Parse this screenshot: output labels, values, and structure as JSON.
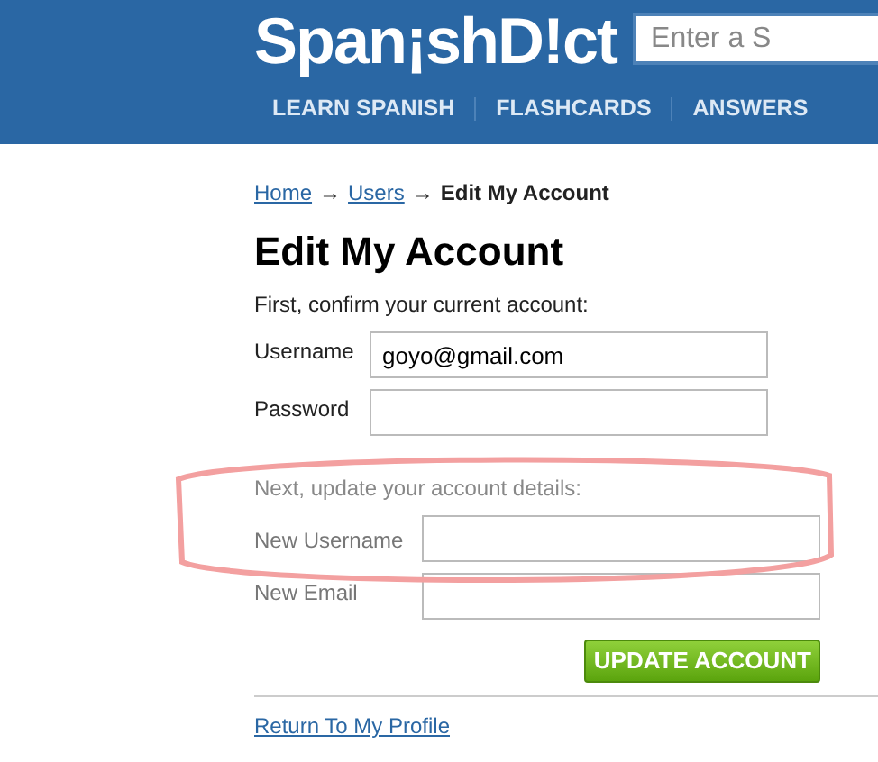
{
  "header": {
    "logo": "Span¡shD!ct",
    "search": {
      "placeholder": "Enter a S"
    },
    "nav": [
      "LEARN SPANISH",
      "FLASHCARDS",
      "ANSWERS"
    ]
  },
  "breadcrumb": {
    "links": [
      "Home",
      "Users"
    ],
    "separator": "→",
    "current": "Edit My Account"
  },
  "title": "Edit My Account",
  "sections": [
    {
      "intro": "First, confirm your current account:",
      "faded": false,
      "fields": [
        {
          "label": "Username",
          "value": "goyo@gmail.com"
        },
        {
          "label": "Password"
        }
      ]
    },
    {
      "intro": "Next, update your account details:",
      "faded": true,
      "fields": [
        {
          "label": "New Username"
        },
        {
          "label": "New Email"
        }
      ]
    }
  ],
  "submit": "UPDATE ACCOUNT",
  "return_link": "Return To My Profile"
}
